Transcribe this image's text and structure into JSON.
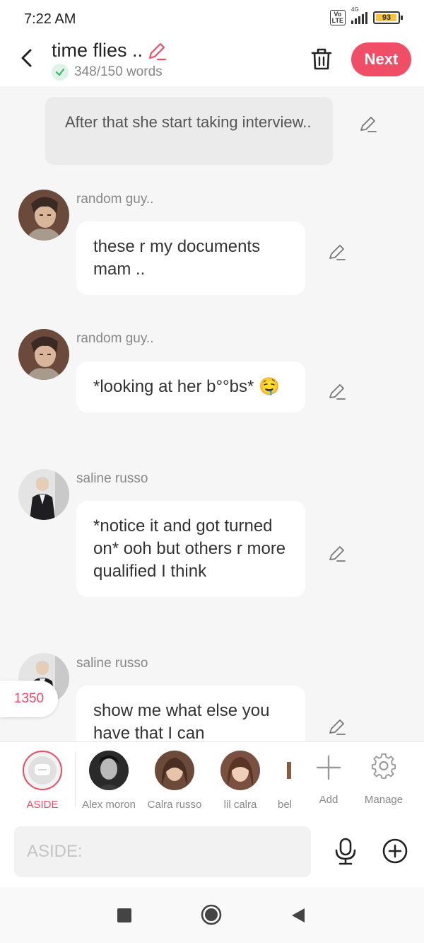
{
  "status_bar": {
    "time": "7:22 AM",
    "network": "4G",
    "battery": "93"
  },
  "header": {
    "title": "time flies ..",
    "word_count": "348/150 words",
    "next_label": "Next"
  },
  "chat": {
    "narration": "After that she start taking interview..",
    "messages": [
      {
        "name": "random guy..",
        "text": "these r my documents mam .."
      },
      {
        "name": "random guy..",
        "text": "*looking at her b°°bs* 🤤"
      },
      {
        "name": "saline russo",
        "text": "*notice it and got turned on* ooh but others r more qualified I think"
      },
      {
        "name": "saline russo",
        "text": "show me what else you have that I can"
      }
    ],
    "count_badge": "1350"
  },
  "characters": {
    "aside": "ASIDE",
    "items": [
      {
        "label": "Alex moron"
      },
      {
        "label": "Calra  russo"
      },
      {
        "label": "lil calra"
      },
      {
        "label": "bel"
      }
    ],
    "add_label": "Add",
    "manage_label": "Manage"
  },
  "input": {
    "placeholder": "ASIDE:"
  },
  "colors": {
    "accent": "#f04e66",
    "background": "#f6f6f6",
    "bubble": "#ffffff"
  }
}
